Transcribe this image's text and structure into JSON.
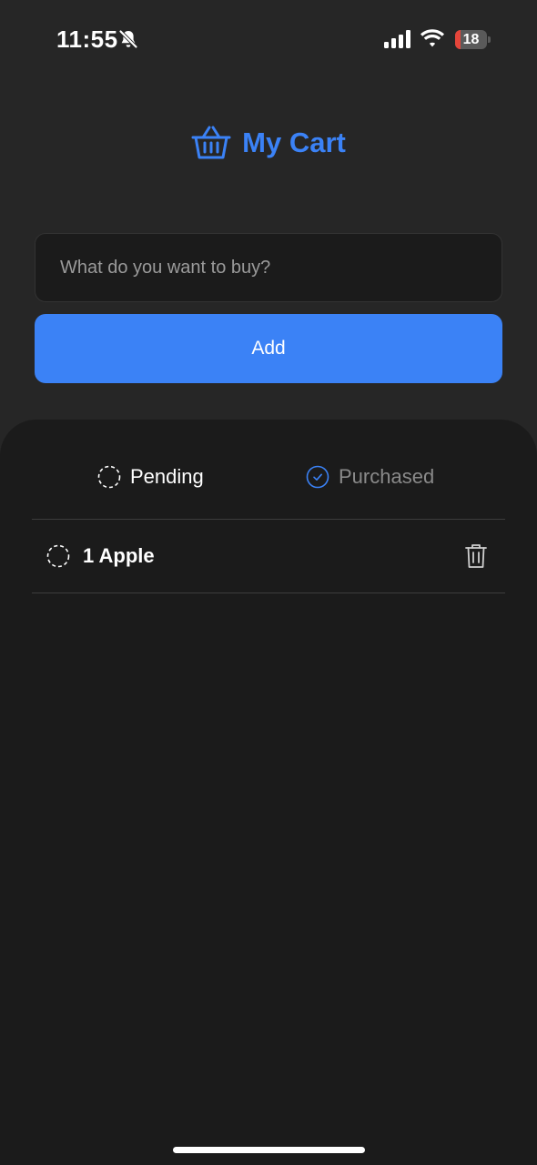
{
  "status_bar": {
    "time": "11:55",
    "battery_level": "18",
    "battery_fraction": 0.18,
    "icons": [
      "bell-slash-icon",
      "signal-icon",
      "wifi-icon",
      "battery-icon"
    ]
  },
  "header": {
    "title": "My Cart",
    "icon": "basket-icon"
  },
  "add_form": {
    "placeholder": "What do you want to buy?",
    "value": "",
    "add_label": "Add"
  },
  "tabs": {
    "pending_label": "Pending",
    "purchased_label": "Purchased",
    "selected": "pending"
  },
  "items": [
    {
      "label": "1 Apple",
      "purchased": false
    }
  ],
  "colors": {
    "accent": "#3b82f6",
    "background": "#262626",
    "panel": "#1b1b1b",
    "muted_text": "#8a8a8a"
  }
}
